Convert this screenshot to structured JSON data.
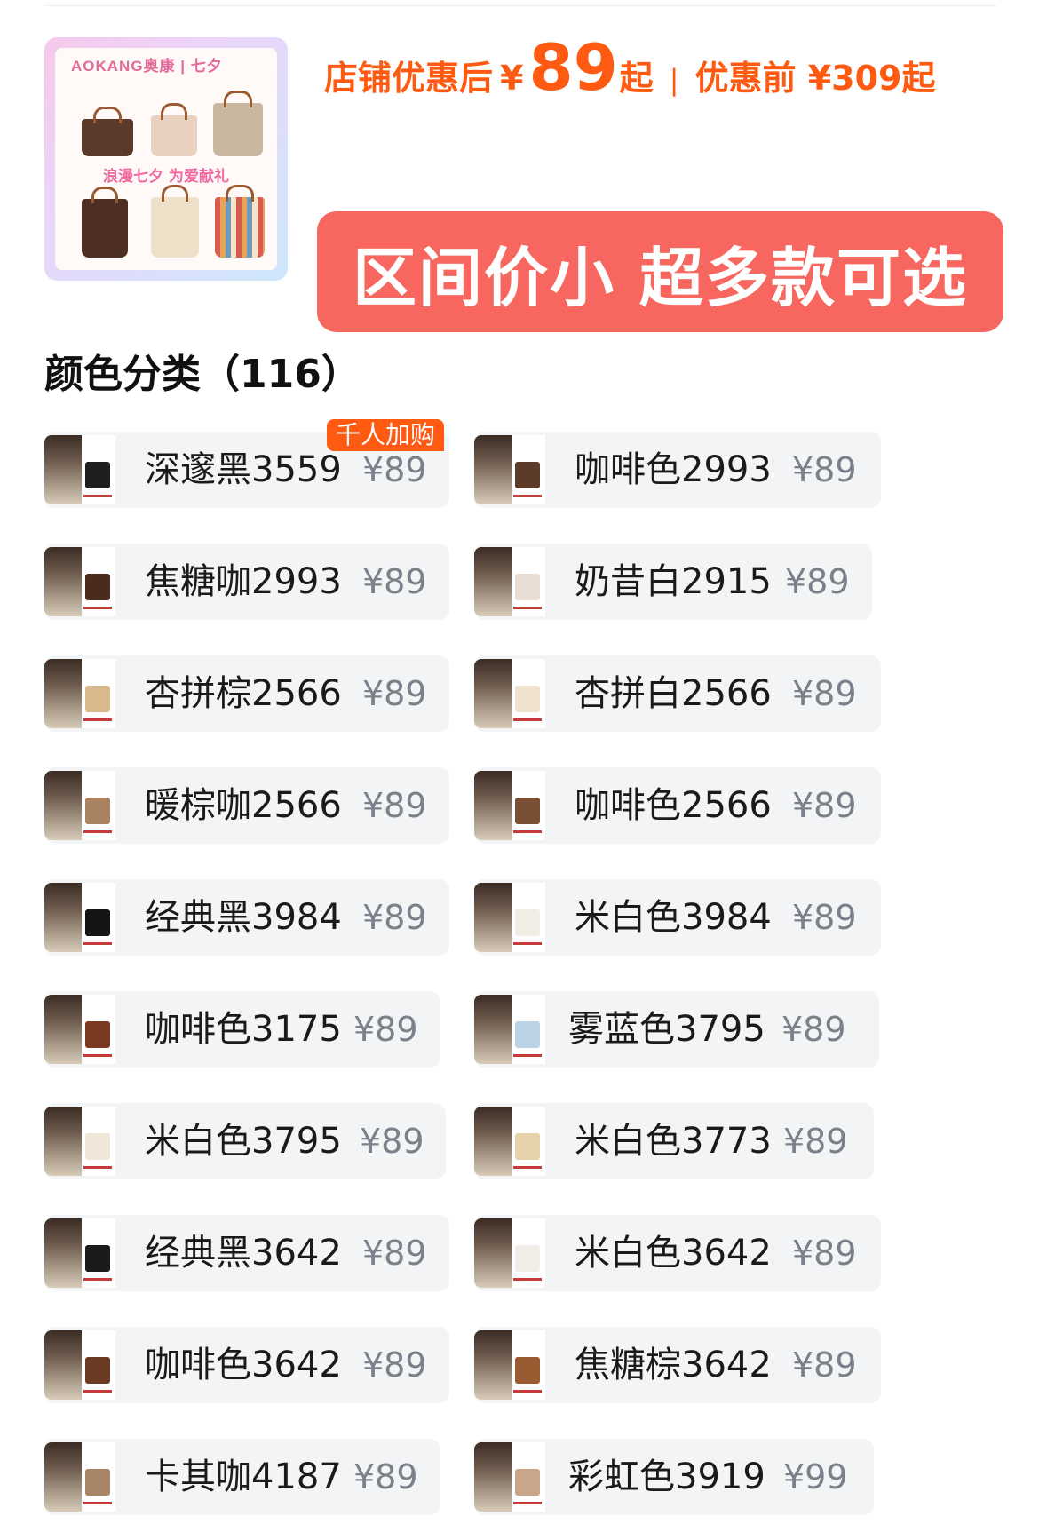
{
  "product": {
    "brand_text": "AOKANG奥康 | 七夕",
    "slogan": "浪漫七夕 为爱献礼"
  },
  "price": {
    "after_discount_label": "店铺优惠后",
    "currency": "¥",
    "after_discount_value": "89",
    "after_suffix": "起",
    "separator": "|",
    "original": "优惠前 ¥309起"
  },
  "banner": {
    "text": "区间价小 超多款可选"
  },
  "section": {
    "title": "颜色分类（116）"
  },
  "badge": {
    "popular": "千人加购"
  },
  "options": [
    {
      "name": "深邃黑3559",
      "price": "¥89"
    },
    {
      "name": "咖啡色2993",
      "price": "¥89"
    },
    {
      "name": "焦糖咖2993",
      "price": "¥89"
    },
    {
      "name": "奶昔白2915",
      "price": "¥89"
    },
    {
      "name": "杏拼棕2566",
      "price": "¥89"
    },
    {
      "name": "杏拼白2566",
      "price": "¥89"
    },
    {
      "name": "暖棕咖2566",
      "price": "¥89"
    },
    {
      "name": "咖啡色2566",
      "price": "¥89"
    },
    {
      "name": "经典黑3984",
      "price": "¥89"
    },
    {
      "name": "米白色3984",
      "price": "¥89"
    },
    {
      "name": "咖啡色3175",
      "price": "¥89"
    },
    {
      "name": "雾蓝色3795",
      "price": "¥89"
    },
    {
      "name": "米白色3795",
      "price": "¥89"
    },
    {
      "name": "米白色3773",
      "price": "¥89"
    },
    {
      "name": "经典黑3642",
      "price": "¥89"
    },
    {
      "name": "米白色3642",
      "price": "¥89"
    },
    {
      "name": "咖啡色3642",
      "price": "¥89"
    },
    {
      "name": "焦糖棕3642",
      "price": "¥89"
    },
    {
      "name": "卡其咖4187",
      "price": "¥89"
    },
    {
      "name": "彩虹色3919",
      "price": "¥99"
    }
  ],
  "colors": {
    "accent_orange": "#ff5a12",
    "banner_red": "#f7675f",
    "chip_bg": "#f3f4f6",
    "price_gray": "#7b808a"
  }
}
